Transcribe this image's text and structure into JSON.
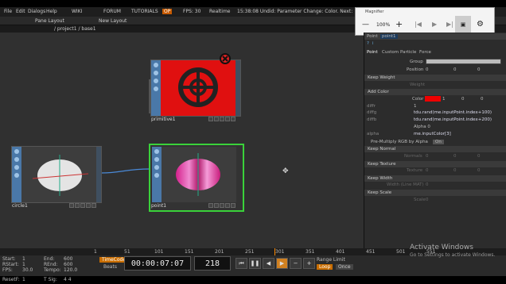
{
  "menu": [
    "File",
    "Edit",
    "Dialogs",
    "Help"
  ],
  "topbar": {
    "wiki": "WIKI",
    "forum": "FORUM",
    "tutorials": "TUTORIALS",
    "op": "OP",
    "fps": "FPS: 30",
    "realtime": "Realtime",
    "status": "15:38:08 Undid: Parameter Change: Color. Next: Paramet"
  },
  "pathbar": {
    "pane_layout": "Pane Layout",
    "new_layout": "New Layout",
    "path": "/ project1 / base1"
  },
  "nodes": {
    "primitive": "primitive1",
    "circle": "circle1",
    "point": "point1"
  },
  "magnifier": {
    "title": "Magnifier",
    "zoom": "100%",
    "minus": "—",
    "plus": "+"
  },
  "panel": {
    "title": "Point",
    "name": "point1",
    "tabs": [
      "Point",
      "Custom",
      "Particle",
      "Force"
    ],
    "group_label": "Group",
    "position_label": "Position",
    "position": [
      "0",
      "0",
      "0"
    ],
    "keep_weight": "Keep Weight",
    "weight_label": "Weight",
    "weight": "0",
    "add_color": "Add Color",
    "color_label": "Color",
    "color_vals": [
      "1",
      "0",
      "0"
    ],
    "rows": [
      {
        "label": "diffr",
        "val": "1"
      },
      {
        "label": "diffg",
        "val": "tdu.rand(me.inputPoint.index+100)"
      },
      {
        "label": "diffb",
        "val": "tdu.rand(me.inputPoint.index+200)"
      },
      {
        "label": "",
        "val": "Alpha   0"
      },
      {
        "label": "alpha",
        "val": "me.inputColor[3]"
      }
    ],
    "premult": "Pre-Multiply RGB by Alpha",
    "premult_state": "On",
    "keep_normal": "Keep Normal",
    "normals": "Normals",
    "normals_vals": [
      "0",
      "0",
      "0"
    ],
    "keep_texture": "Keep Texture",
    "texture": "Texture",
    "texture_vals": [
      "0",
      "0",
      "0"
    ],
    "keep_width": "Keep Width",
    "width_label": "Width (Line MAT)",
    "width_val": "0",
    "keep_scale": "Keep Scale",
    "scale_label": "Scale",
    "scale_val": "0"
  },
  "bottom": {
    "start": "Start:",
    "start_v": "1",
    "end": "End:",
    "end_v": "600",
    "rstart": "RStart:",
    "rstart_v": "1",
    "rend": "REnd:",
    "rend_v": "600",
    "fps": "FPS:",
    "fps_v": "30.0",
    "tempo": "Tempo:",
    "tempo_v": "120.0",
    "reset": "ResetF:",
    "reset_v": "1",
    "tsig": "T Sig:",
    "tsig_v": "4    4",
    "timecode": "TimeCode",
    "beats": "Beats",
    "time": "00:00:07:07",
    "frame": "218",
    "range_limit": "Range Limit",
    "loop": "Loop",
    "once": "Once",
    "ticks": [
      "1",
      "51",
      "101",
      "151",
      "201",
      "251",
      "301",
      "351",
      "401",
      "451",
      "501",
      "551"
    ]
  },
  "watermark": {
    "line1": "Activate Windows",
    "line2": "Go to Settings to activate Windows."
  }
}
